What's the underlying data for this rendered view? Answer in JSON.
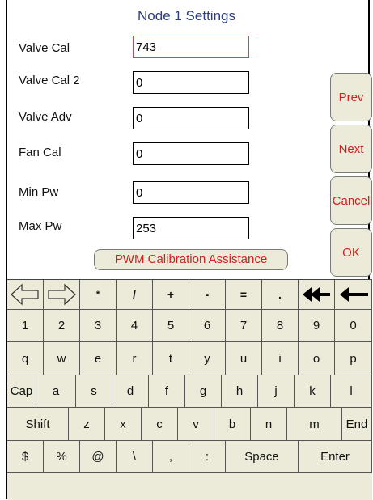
{
  "title": "Node 1 Settings",
  "fields": [
    {
      "label": "Valve Cal",
      "value": "743"
    },
    {
      "label": "Valve Cal 2",
      "value": "0"
    },
    {
      "label": "Valve Adv",
      "value": "0"
    },
    {
      "label": "Fan Cal",
      "value": "0"
    },
    {
      "label": "Min Pw",
      "value": "0"
    },
    {
      "label": "Max Pw",
      "value": "253"
    }
  ],
  "side_buttons": {
    "prev": "Prev",
    "next": "Next",
    "cancel": "Cancel",
    "ok": "OK"
  },
  "pwm_button": "PWM Calibration Assistance",
  "keyboard": {
    "row1": [
      "*",
      "/",
      "+",
      "-",
      "=",
      "."
    ],
    "row2": [
      "1",
      "2",
      "3",
      "4",
      "5",
      "6",
      "7",
      "8",
      "9",
      "0"
    ],
    "row3": [
      "q",
      "w",
      "e",
      "r",
      "t",
      "y",
      "u",
      "i",
      "o",
      "p"
    ],
    "row4": [
      "Cap",
      "a",
      "s",
      "d",
      "f",
      "g",
      "h",
      "j",
      "k",
      "l"
    ],
    "row5": [
      "Shift",
      "z",
      "x",
      "c",
      "v",
      "b",
      "n",
      "m",
      "End"
    ],
    "row6": [
      "$",
      "%",
      "@",
      "\\",
      ",",
      ":",
      "Space",
      "Enter"
    ]
  },
  "icons": {
    "left": "arrow-left-outline-icon",
    "right": "arrow-right-outline-icon",
    "back_double": "double-backspace-icon",
    "backspace": "backspace-arrow-icon"
  },
  "colors": {
    "title": "#2b3f86",
    "button_text": "#d31f1f",
    "button_bg": "#ecead8",
    "active_border": "#e04040"
  }
}
